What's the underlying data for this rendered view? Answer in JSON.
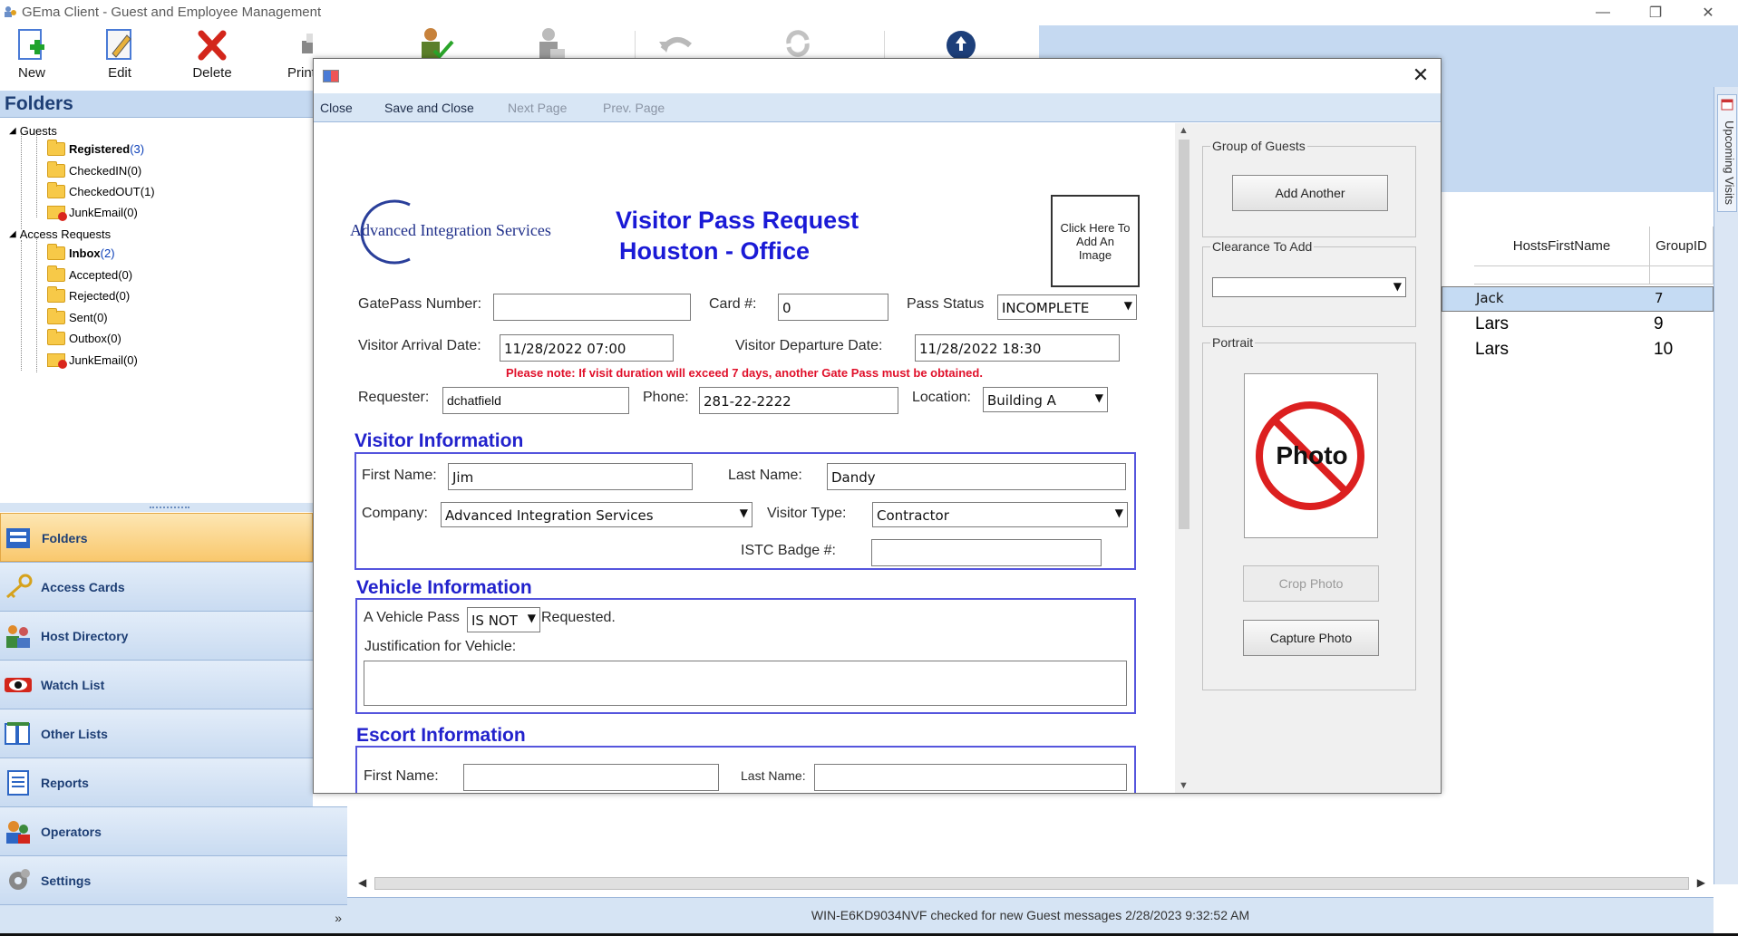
{
  "window": {
    "title": "GEma Client - Guest and Employee Management",
    "minimize": "—",
    "restore": "❐",
    "close": "✕"
  },
  "toolbar": {
    "new": "New",
    "edit": "Edit",
    "delete": "Delete",
    "print": "Print"
  },
  "folders": {
    "title": "Folders",
    "guests_label": "Guests",
    "guests": [
      {
        "name": "Registered",
        "count": "(3)",
        "bold": true
      },
      {
        "name": "CheckedIN(0)"
      },
      {
        "name": "CheckedOUT(1)"
      },
      {
        "name": "JunkEmail(0)"
      }
    ],
    "access_label": "Access Requests",
    "access": [
      {
        "name": "Inbox",
        "count": "(2)",
        "bold": true
      },
      {
        "name": "Accepted(0)"
      },
      {
        "name": "Rejected(0)"
      },
      {
        "name": "Sent(0)"
      },
      {
        "name": "Outbox(0)"
      },
      {
        "name": "JunkEmail(0)"
      }
    ]
  },
  "nav": [
    {
      "label": "Folders",
      "active": true
    },
    {
      "label": "Access Cards"
    },
    {
      "label": "Host Directory"
    },
    {
      "label": "Watch List"
    },
    {
      "label": "Other Lists"
    },
    {
      "label": "Reports"
    },
    {
      "label": "Operators"
    },
    {
      "label": "Settings"
    }
  ],
  "nav_footer_chevron": "»",
  "grid": {
    "columns": [
      "HostsFirstName",
      "GroupID"
    ],
    "rows": [
      {
        "first": "Jack",
        "group": "7",
        "selected": true
      },
      {
        "first": "Lars",
        "group": "9"
      },
      {
        "first": "Lars",
        "group": "10"
      }
    ]
  },
  "upcoming_tab": "Upcoming Visits",
  "status": "WIN-E6KD9034NVF checked for new Guest messages 2/28/2023 9:32:52 AM",
  "dialog": {
    "menu": {
      "close": "Close",
      "save_close": "Save and Close",
      "next_page": "Next Page",
      "prev_page": "Prev. Page"
    },
    "logo_text": "Advanced Integration Services",
    "headline1": "Visitor Pass Request",
    "headline2": "Houston - Office",
    "image_button": "Click Here To Add An Image",
    "fields": {
      "gatepass_label": "GatePass Number:",
      "gatepass_value": "",
      "card_label": "Card #:",
      "card_value": "0",
      "pass_status_label": "Pass Status",
      "pass_status_value": "INCOMPLETE",
      "arrival_label": "Visitor Arrival Date:",
      "arrival_value": "11/28/2022 07:00",
      "departure_label": "Visitor Departure Date:",
      "departure_value": "11/28/2022 18:30",
      "note": "Please note: If visit duration will exceed 7 days, another Gate Pass must be obtained.",
      "requester_label": "Requester:",
      "requester_value": "dchatfield",
      "phone_label": "Phone:",
      "phone_value": "281-22-2222",
      "location_label": "Location:",
      "location_value": "Building A"
    },
    "visitor": {
      "section": "Visitor Information",
      "first_label": "First Name:",
      "first_value": "Jim",
      "last_label": "Last Name:",
      "last_value": "Dandy",
      "company_label": "Company:",
      "company_value": "Advanced Integration Services",
      "type_label": "Visitor Type:",
      "type_value": "Contractor",
      "badge_label": "ISTC Badge #:",
      "badge_value": ""
    },
    "vehicle": {
      "section": "Vehicle Information",
      "pass_prefix": "A Vehicle Pass",
      "pass_value": "IS NOT",
      "pass_suffix": "Requested.",
      "justification_label": "Justification for Vehicle:",
      "justification_value": ""
    },
    "escort": {
      "section": "Escort Information",
      "first_label": "First Name:",
      "first_value": "",
      "last_label": "Last Name:",
      "last_value": ""
    },
    "side": {
      "group_title": "Group of Guests",
      "add_another": "Add Another",
      "clearance_title": "Clearance To Add",
      "clearance_value": "",
      "portrait_title": "Portrait",
      "photo_text": "Photo",
      "crop_photo": "Crop Photo",
      "capture_photo": "Capture Photo"
    }
  }
}
